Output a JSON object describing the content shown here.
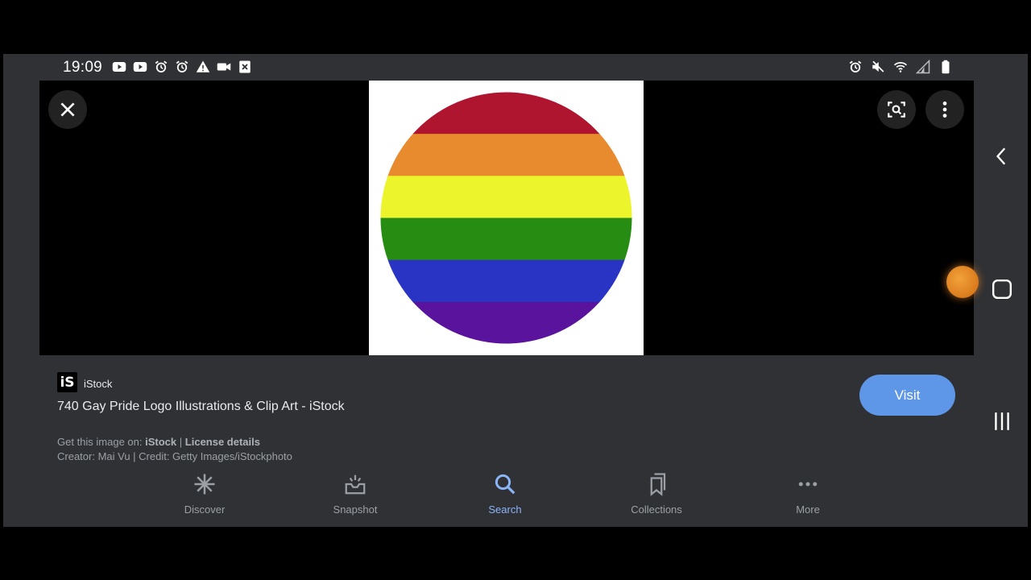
{
  "status_bar": {
    "time": "19:09",
    "left_icons": [
      "youtube-icon",
      "youtube-icon",
      "alarm-icon",
      "alarm-icon",
      "warning-icon",
      "video-icon",
      "close-box-icon"
    ],
    "right_icons": [
      "alarm-icon",
      "mute-icon",
      "wifi-icon",
      "signal-icon",
      "battery-icon"
    ]
  },
  "image_viewer": {
    "image_description": "rainbow-circle",
    "stripe_colors": [
      "#b01530",
      "#e88b2e",
      "#ecf52c",
      "#278d12",
      "#2a34c4",
      "#5a139c"
    ],
    "close_icon": "close-icon",
    "lens_icon": "lens-search-icon",
    "menu_icon": "more-vert-icon"
  },
  "result": {
    "source_name": "iStock",
    "source_logo": "iS",
    "title": "740 Gay Pride Logo Illustrations & Clip Art - iStock",
    "visit_label": "Visit",
    "get_image_prefix": "Get this image on:",
    "get_image_source": "iStock",
    "separator": "|",
    "license_label": "License details",
    "credit_line": "Creator: Mai Vu | Credit: Getty Images/iStockphoto"
  },
  "bottom_nav": {
    "items": [
      {
        "label": "Discover",
        "icon": "discover-icon"
      },
      {
        "label": "Snapshot",
        "icon": "snapshot-icon"
      },
      {
        "label": "Search",
        "icon": "search-icon"
      },
      {
        "label": "Collections",
        "icon": "collections-icon"
      },
      {
        "label": "More",
        "icon": "more-horiz-icon"
      }
    ],
    "active": "Search"
  },
  "system_nav": [
    "back-icon",
    "home-icon",
    "recents-icon"
  ],
  "colors": {
    "panel": "#303134",
    "accent": "#8ab4f8",
    "visit_button": "#5f97e8"
  }
}
